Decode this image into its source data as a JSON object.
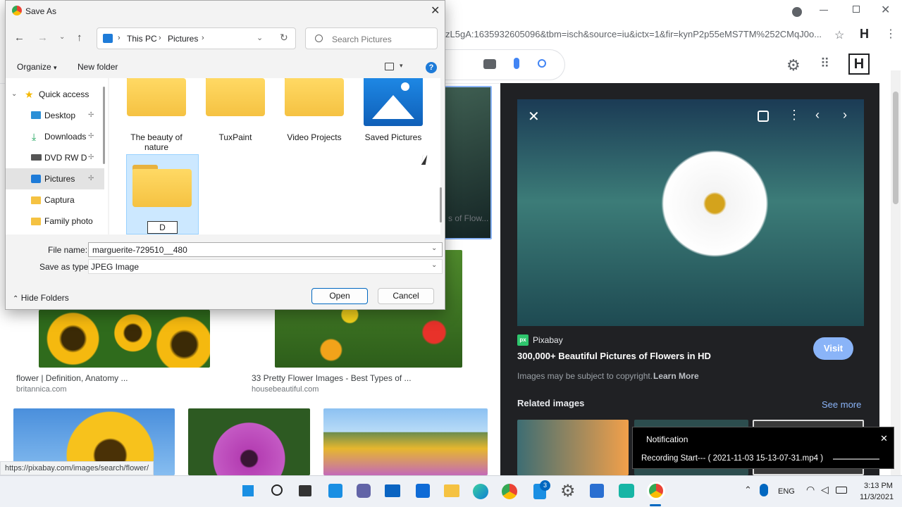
{
  "browser": {
    "url_text": "zL5gA:1635932605096&tbm=isch&source=iu&ictx=1&fir=kynP2p55eMS7TM%252CMqJ0o...",
    "status_url": "https://pixabay.com/images/search/flower/"
  },
  "results": [
    {
      "caption": "flower | Definition, Anatomy ...",
      "source": "britannica.com"
    },
    {
      "caption": "33 Pretty Flower Images - Best Types of ...",
      "source": "housebeautiful.com"
    },
    {
      "caption": "s of Flow..."
    }
  ],
  "preview": {
    "site": "Pixabay",
    "title": "300,000+ Beautiful Pictures of Flowers in HD",
    "visit_label": "Visit",
    "copyright": "Images may be subject to copyright.",
    "learn_more": "Learn More",
    "related_label": "Related images",
    "see_more": "See more"
  },
  "dialog": {
    "title": "Save As",
    "breadcrumb": [
      "This PC",
      "Pictures"
    ],
    "search_placeholder": "Search Pictures",
    "organize": "Organize",
    "new_folder": "New folder",
    "nav_items": [
      {
        "label": "Quick access",
        "icon": "star-icon"
      },
      {
        "label": "Desktop",
        "icon": "desktop-icon"
      },
      {
        "label": "Downloads",
        "icon": "download-icon"
      },
      {
        "label": "DVD RW Dri",
        "icon": "dvd-drive-icon"
      },
      {
        "label": "Pictures",
        "icon": "pictures-icon"
      },
      {
        "label": "Captura",
        "icon": "folder-icon"
      },
      {
        "label": "Family photo",
        "icon": "folder-icon"
      }
    ],
    "folders": [
      {
        "label": "The beauty of nature"
      },
      {
        "label": "TuxPaint"
      },
      {
        "label": "Video Projects"
      },
      {
        "label": "Saved Pictures"
      }
    ],
    "new_folder_name": "D",
    "file_name_label": "File name:",
    "file_name_value": "marguerite-729510__480",
    "save_type_label": "Save as type:",
    "save_type_value": "JPEG Image",
    "hide_folders": "Hide Folders",
    "open_label": "Open",
    "cancel_label": "Cancel"
  },
  "notification": {
    "title": "Notification",
    "message": "Recording Start--- ( 2021-11-03 15-13-07-31.mp4 )"
  },
  "taskbar": {
    "language": "ENG",
    "time": "3:13 PM",
    "date": "11/3/2021",
    "badge_count": "3"
  },
  "colors": {
    "accent": "#0067c0",
    "visit": "#8ab4f8",
    "dark_bg": "#202124"
  }
}
